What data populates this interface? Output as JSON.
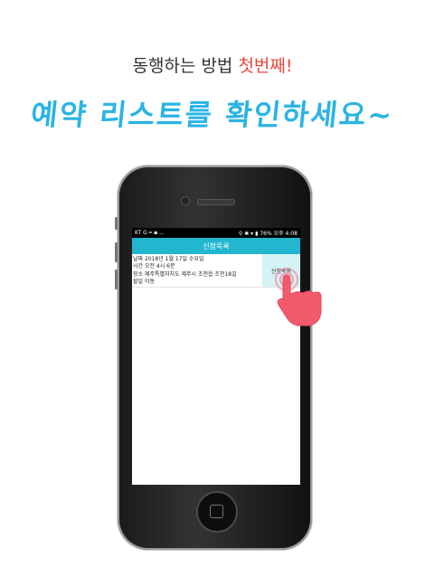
{
  "headline": {
    "main": "동행하는 방법",
    "accent": "첫번째!"
  },
  "title": "예약 리스트를 확인하세요~",
  "status": {
    "carrier": "KT",
    "icons_left": "G ━ ▪ ...",
    "battery": "76%",
    "time": "오후 4:08"
  },
  "appbar": {
    "title": "신청목록"
  },
  "reservation": {
    "date": "날짜 2018년 1월 17일 수요일",
    "time": "시간 오전 4시 6분",
    "place": "장소 제주특별자치도 제주시 조천읍 조천18길",
    "todo": "할일 이동",
    "action_label": "신청목록"
  },
  "colors": {
    "accent_red": "#e8453c",
    "title_blue": "#2ab4e4",
    "appbar": "#22b6cf"
  }
}
